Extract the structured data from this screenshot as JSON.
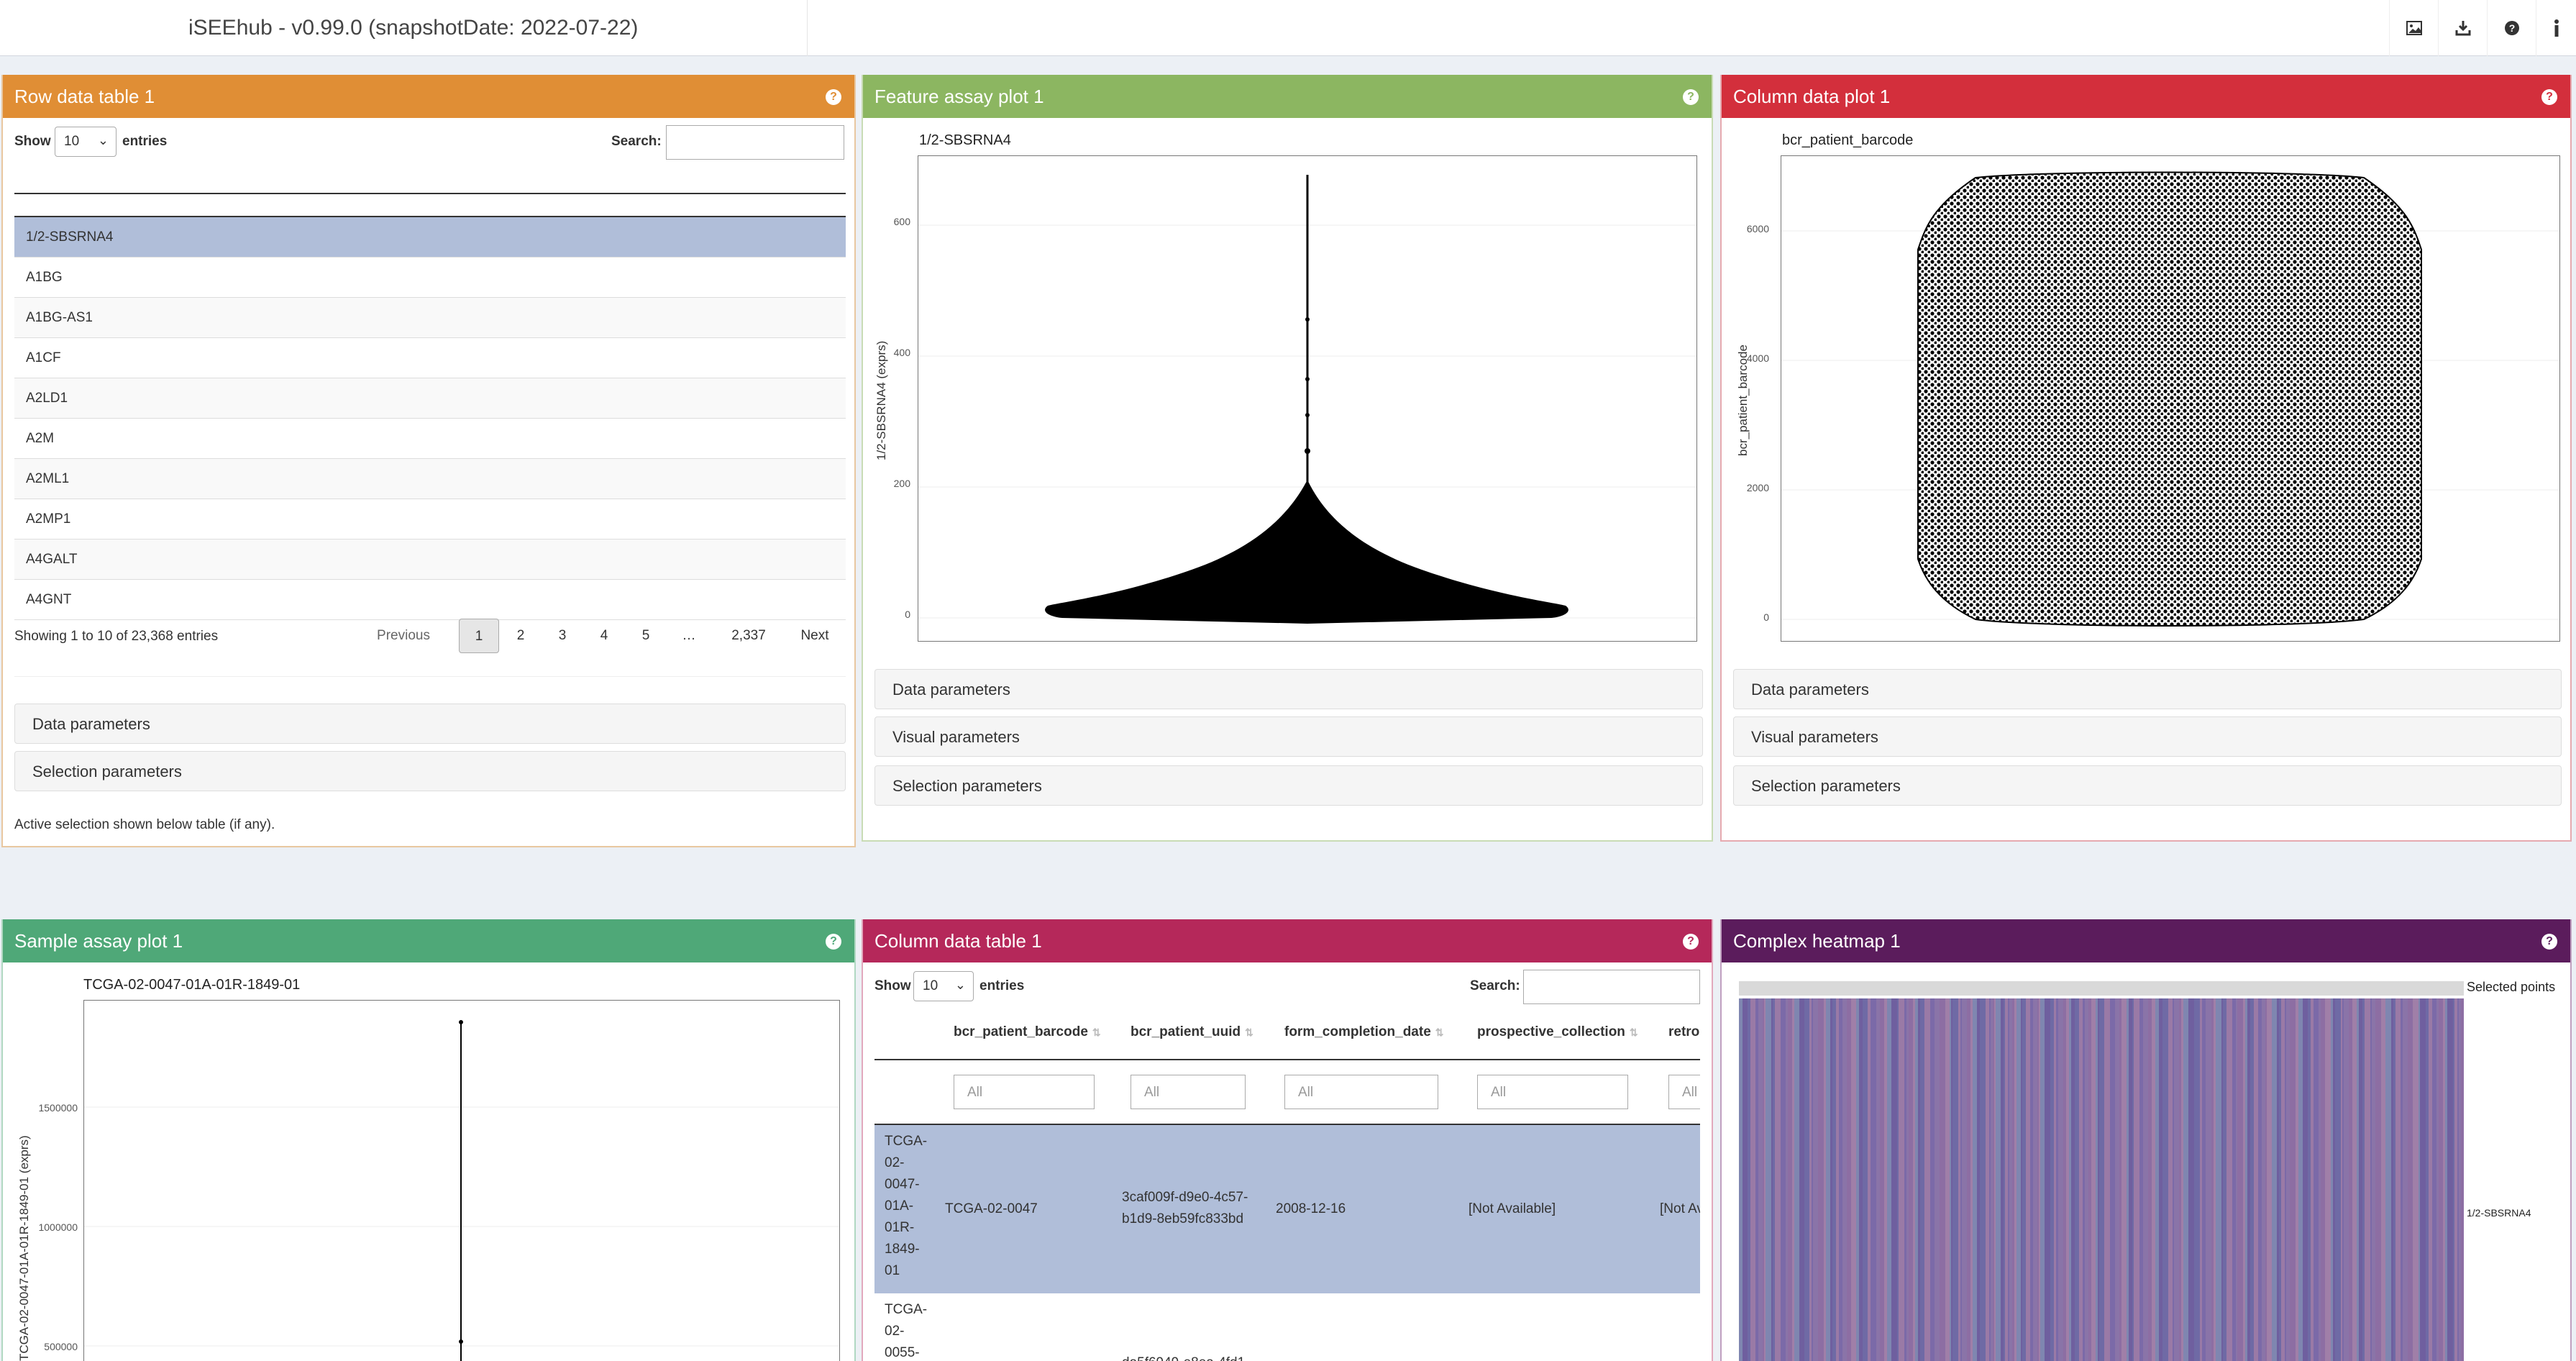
{
  "app": {
    "title": "iSEEhub - v0.99.0 (snapshotDate: 2022-07-22)",
    "header_icons": [
      "image-export-icon",
      "download-icon",
      "help-icon",
      "info-icon"
    ]
  },
  "panels": {
    "row_table": {
      "title": "Row data table 1",
      "color": "#e08e35",
      "show_label": "Show",
      "entries_value": "10",
      "entries_label": "entries",
      "search_label": "Search:",
      "rows": [
        "1/2-SBSRNA4",
        "A1BG",
        "A1BG-AS1",
        "A1CF",
        "A2LD1",
        "A2M",
        "A2ML1",
        "A2MP1",
        "A4GALT",
        "A4GNT"
      ],
      "selected_row": "1/2-SBSRNA4",
      "info": "Showing 1 to 10 of 23,368 entries",
      "pager": {
        "previous": "Previous",
        "pages": [
          "1",
          "2",
          "3",
          "4",
          "5",
          "…",
          "2,337"
        ],
        "next": "Next",
        "current": "1"
      },
      "sections": [
        "Data parameters",
        "Selection parameters"
      ],
      "footer_note": "Active selection shown below table (if any)."
    },
    "feature_plot": {
      "title": "Feature assay plot 1",
      "color": "#8cb661",
      "plot_title": "1/2-SBSRNA4",
      "y_label": "1/2-SBSRNA4 (exprs)",
      "y_ticks": [
        "600",
        "400",
        "200",
        "0"
      ],
      "sections": [
        "Data parameters",
        "Visual parameters",
        "Selection parameters"
      ]
    },
    "column_plot": {
      "title": "Column data plot 1",
      "color": "#d32f3c",
      "plot_title": "bcr_patient_barcode",
      "y_label": "bcr_patient_barcode",
      "y_ticks": [
        "6000",
        "4000",
        "2000",
        "0"
      ],
      "sections": [
        "Data parameters",
        "Visual parameters",
        "Selection parameters"
      ]
    },
    "sample_plot": {
      "title": "Sample assay plot 1",
      "color": "#4fa878",
      "plot_title": "TCGA-02-0047-01A-01R-1849-01",
      "y_label": "TCGA-02-0047-01A-01R-1849-01 (exprs)",
      "y_ticks": [
        "1500000",
        "1000000",
        "500000"
      ]
    },
    "column_table": {
      "title": "Column data table 1",
      "color": "#b5285a",
      "show_label": "Show",
      "entries_value": "10",
      "entries_label": "entries",
      "search_label": "Search:",
      "columns": [
        "bcr_patient_barcode",
        "bcr_patient_uuid",
        "form_completion_date",
        "prospective_collection",
        "retro"
      ],
      "filter_placeholder": "All",
      "row1": {
        "rowname": [
          "TCGA-",
          "02-",
          "0047-",
          "01A-",
          "01R-",
          "1849-",
          "01"
        ],
        "barcode": "TCGA-02-0047",
        "uuid": [
          "3caf009f-d9e0-4c57-",
          "b1d9-8eb59fc833bd"
        ],
        "date": "2008-12-16",
        "prospective": "[Not Available]",
        "retro": "[Not Av"
      },
      "row2": {
        "rowname": [
          "TCGA-",
          "02-",
          "0055-"
        ],
        "uuid_partial": "da5f6949-e8ea-4fd1"
      }
    },
    "heatmap": {
      "title": "Complex heatmap 1",
      "color": "#5b1c5c",
      "legend_selected": "Selected points",
      "row_label": "1/2-SBSRNA4"
    }
  }
}
